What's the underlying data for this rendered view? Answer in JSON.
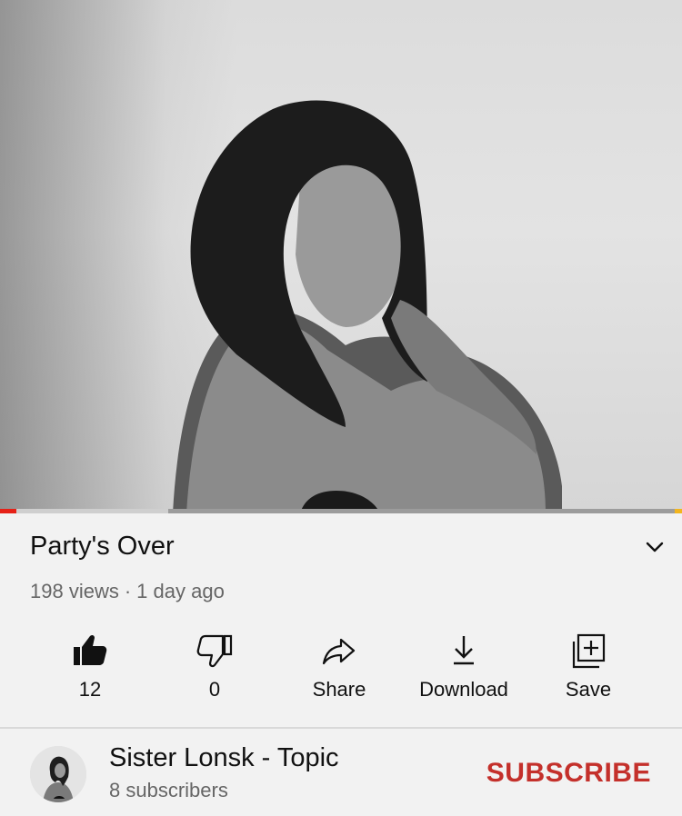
{
  "video": {
    "title": "Party's Over",
    "views": "198 views",
    "separator": "·",
    "uploaded": "1 day ago",
    "progress_played": 0.024,
    "progress_buffered": 0.247
  },
  "actions": [
    {
      "name": "like",
      "label": "12",
      "icon": "thumbs-up-icon"
    },
    {
      "name": "dislike",
      "label": "0",
      "icon": "thumbs-down-icon"
    },
    {
      "name": "share",
      "label": "Share",
      "icon": "share-arrow-icon"
    },
    {
      "name": "download",
      "label": "Download",
      "icon": "download-icon"
    },
    {
      "name": "save",
      "label": "Save",
      "icon": "add-to-playlist-icon"
    }
  ],
  "channel": {
    "name": "Sister Lonsk - Topic",
    "subscribers": "8 subscribers",
    "subscribe_label": "SUBSCRIBE"
  },
  "colors": {
    "accent_red": "#c4302b",
    "progress_red": "#e62117"
  }
}
